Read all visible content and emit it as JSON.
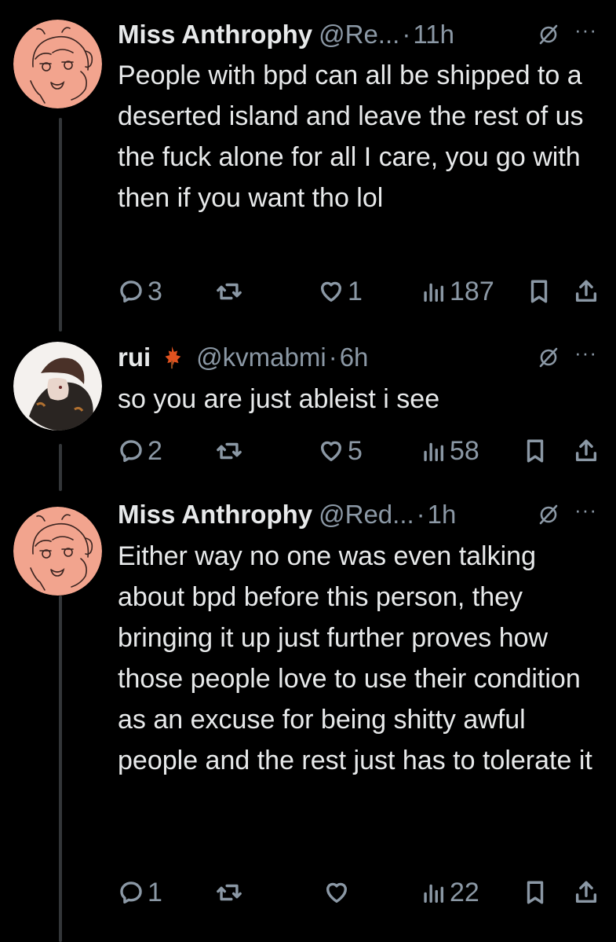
{
  "tweets": [
    {
      "name": "Miss Anthrophy",
      "handle": "@Re...",
      "dot": "·",
      "time": "11h",
      "text": "People with bpd can all be shipped to a deserted island and leave the rest of us the fuck alone for all I care, you go with then if you want tho lol",
      "replies": "3",
      "retweets": "",
      "likes": "1",
      "views": "187",
      "avatar": "pink-cartoon-avatar"
    },
    {
      "name": "rui",
      "handle": "@kvmabmi",
      "dot": "·",
      "time": "6h",
      "text": "so you are just ableist i see",
      "replies": "2",
      "retweets": "",
      "likes": "5",
      "views": "58",
      "avatar": "anime-avatar"
    },
    {
      "name": "Miss Anthrophy",
      "handle": "@Red...",
      "dot": "·",
      "time": "1h",
      "text": "Either way no one was even talking about bpd before this person, they bringing it up just further proves how those people love to use their condition as an excuse for being shitty awful people and the rest just has to tolerate it",
      "replies": "1",
      "retweets": "",
      "likes": "",
      "views": "22",
      "avatar": "pink-cartoon-avatar"
    }
  ],
  "more_label": "···",
  "colors": {
    "background": "#000000",
    "text": "#e7e9ea",
    "muted": "#8b98a5",
    "avatar_pink": "#f2a48e"
  }
}
